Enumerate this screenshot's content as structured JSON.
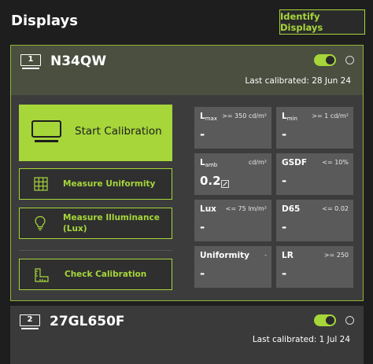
{
  "header": {
    "title": "Displays",
    "identify_label": "Identify Displays"
  },
  "displays": [
    {
      "number": "1",
      "name": "N34QW",
      "enabled": true,
      "last_calibrated": "Last calibrated: 28 Jun 24",
      "actions": {
        "start": "Start Calibration",
        "uniformity": "Measure Uniformity",
        "illuminance_1": "Measure Illuminance",
        "illuminance_2": "(Lux)",
        "check": "Check Calibration"
      },
      "metrics": [
        {
          "name": "L",
          "sub": "max",
          "cond": ">= 350 cd/m²",
          "value": "-"
        },
        {
          "name": "L",
          "sub": "min",
          "cond": ">= 1 cd/m²",
          "value": "-"
        },
        {
          "name": "L",
          "sub": "amb",
          "cond": "cd/m²",
          "value": "0.2"
        },
        {
          "name": "GSDF",
          "sub": "",
          "cond": "<= 10%",
          "value": "-"
        },
        {
          "name": "Lux",
          "sub": "",
          "cond": "<= 75 lm/m²",
          "value": "-"
        },
        {
          "name": "D65",
          "sub": "",
          "cond": "<= 0.02",
          "value": "-"
        },
        {
          "name": "Uniformity",
          "sub": "",
          "cond": "-",
          "value": "-"
        },
        {
          "name": "LR",
          "sub": "",
          "cond": ">= 250",
          "value": "-"
        }
      ]
    },
    {
      "number": "2",
      "name": "27GL650F",
      "enabled": true,
      "last_calibrated": "Last calibrated: 1 Jul 24"
    }
  ],
  "colors": {
    "accent": "#a6d63a",
    "background": "#1e1e1e",
    "tile": "#5a5a5a"
  },
  "icons": {
    "monitor": "monitor-icon",
    "grid": "grid-icon",
    "bulb": "lightbulb-icon",
    "check": "ruler-icon",
    "edit": "edit-icon"
  }
}
